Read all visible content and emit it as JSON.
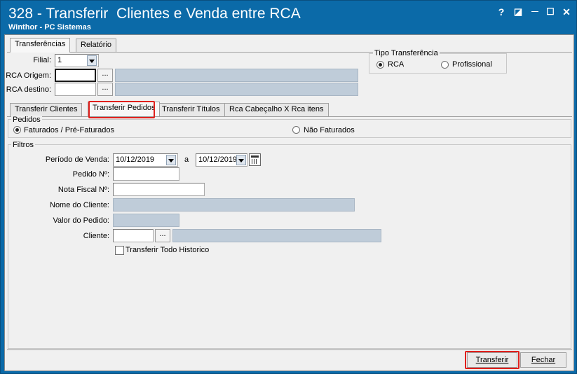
{
  "window": {
    "title": "328 - Transferir  Clientes e Venda entre RCA",
    "subtitle": "Winthor - PC Sistemas",
    "help_label": "?",
    "restore_label": "◪",
    "minimize_label": "—",
    "maximize_label": "☐",
    "close_label": "✕"
  },
  "top_tabs": [
    {
      "label": "Transferências",
      "active": true
    },
    {
      "label": "Relatório",
      "active": false
    }
  ],
  "header_form": {
    "filial_label": "Filial:",
    "filial_value": "1",
    "rca_origem_label": "RCA Origem:",
    "rca_origem_value": "",
    "rca_destino_label": "RCA destino:",
    "rca_destino_value": "",
    "lookup_button": "..."
  },
  "tipo_transferencia": {
    "title": "Tipo Transferência",
    "options": [
      {
        "label": "RCA",
        "selected": true
      },
      {
        "label": "Profissional",
        "selected": false
      }
    ]
  },
  "sub_tabs": [
    {
      "label": "Transferir Clientes",
      "active": false
    },
    {
      "label": "Transferir Pedidos",
      "active": true
    },
    {
      "label": "Transferir Títulos",
      "active": false
    },
    {
      "label": "Rca Cabeçalho X Rca itens",
      "active": false
    }
  ],
  "pedidos": {
    "title": "Pedidos",
    "options": [
      {
        "label": "Faturados / Pré-Faturados",
        "selected": true
      },
      {
        "label": "Não Faturados",
        "selected": false
      }
    ]
  },
  "filtros": {
    "title": "Filtros",
    "periodo_label": "Período de Venda:",
    "periodo_from": "10/12/2019",
    "periodo_sep": "a",
    "periodo_to": "10/12/2019",
    "pedido_label": "Pedido Nº:",
    "pedido_value": "",
    "nota_label": "Nota Fiscal Nº:",
    "nota_value": "",
    "nome_cliente_label": "Nome do Cliente:",
    "nome_cliente_value": "",
    "valor_label": "Valor do Pedido:",
    "valor_value": "",
    "cliente_label": "Cliente:",
    "cliente_value": "",
    "cliente_desc_value": "",
    "lookup_button": "...",
    "historico_label": "Transferir Todo Historico",
    "historico_checked": false
  },
  "footer": {
    "transferir_label": "Transferir",
    "fechar_label": "Fechar"
  },
  "colors": {
    "title_bar": "#0b6aa8",
    "readonly_field": "#bfccd9",
    "highlight": "#e0201c"
  }
}
